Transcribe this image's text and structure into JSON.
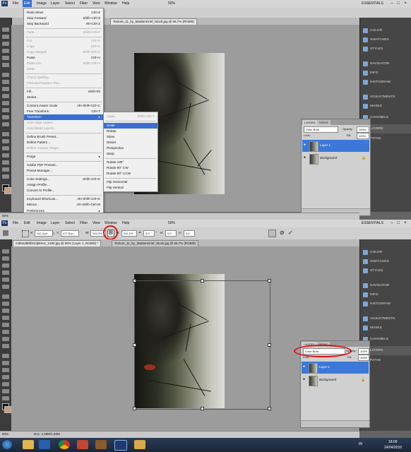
{
  "menubar": {
    "items": [
      "Ps",
      "File",
      "Edit",
      "Image",
      "Layer",
      "Select",
      "Filter",
      "View",
      "Window",
      "Help"
    ],
    "zoom": "50%",
    "workspace": "ESSENTIALS"
  },
  "edit_menu": {
    "items": [
      {
        "label": "Redo Move",
        "shortcut": "Ctrl+Z",
        "disabled": false
      },
      {
        "label": "Step Forward",
        "shortcut": "Shift+Ctrl+Z",
        "disabled": false
      },
      {
        "label": "Step Backward",
        "shortcut": "Alt+Ctrl+Z",
        "disabled": false
      },
      {
        "label": "Fade...",
        "shortcut": "Shift+Ctrl+F",
        "disabled": true
      },
      {
        "label": "Cut",
        "shortcut": "Ctrl+X",
        "disabled": true
      },
      {
        "label": "Copy",
        "shortcut": "Ctrl+C",
        "disabled": true
      },
      {
        "label": "Copy Merged",
        "shortcut": "Shift+Ctrl+C",
        "disabled": true
      },
      {
        "label": "Paste",
        "shortcut": "Ctrl+V",
        "disabled": false
      },
      {
        "label": "Paste Into",
        "shortcut": "Shift+Ctrl+V",
        "disabled": true
      },
      {
        "label": "Clear",
        "shortcut": "",
        "disabled": true
      },
      {
        "label": "Check Spelling...",
        "shortcut": "",
        "disabled": true
      },
      {
        "label": "Find and Replace Text...",
        "shortcut": "",
        "disabled": true
      },
      {
        "label": "Fill...",
        "shortcut": "Shift+F5",
        "disabled": false
      },
      {
        "label": "Stroke...",
        "shortcut": "",
        "disabled": false
      },
      {
        "label": "Content-Aware Scale",
        "shortcut": "Alt+Shift+Ctrl+C",
        "disabled": false
      },
      {
        "label": "Free Transform",
        "shortcut": "Ctrl+T",
        "disabled": false
      },
      {
        "label": "Transform",
        "shortcut": "",
        "disabled": false,
        "highlight": true
      },
      {
        "label": "Auto-Align Layers...",
        "shortcut": "",
        "disabled": true
      },
      {
        "label": "Auto-Blend Layers...",
        "shortcut": "",
        "disabled": true
      },
      {
        "label": "Define Brush Preset...",
        "shortcut": "",
        "disabled": false
      },
      {
        "label": "Define Pattern...",
        "shortcut": "",
        "disabled": false
      },
      {
        "label": "Define Custom Shape...",
        "shortcut": "",
        "disabled": true
      },
      {
        "label": "Purge",
        "shortcut": "",
        "disabled": false
      },
      {
        "label": "Adobe PDF Presets...",
        "shortcut": "",
        "disabled": false
      },
      {
        "label": "Preset Manager...",
        "shortcut": "",
        "disabled": false
      },
      {
        "label": "Color Settings...",
        "shortcut": "Shift+Ctrl+K",
        "disabled": false
      },
      {
        "label": "Assign Profile...",
        "shortcut": "",
        "disabled": false
      },
      {
        "label": "Convert to Profile...",
        "shortcut": "",
        "disabled": false
      },
      {
        "label": "Keyboard Shortcuts...",
        "shortcut": "Alt+Shift+Ctrl+K",
        "disabled": false
      },
      {
        "label": "Menus...",
        "shortcut": "Alt+Shift+Ctrl+M",
        "disabled": false
      },
      {
        "label": "Preferences",
        "shortcut": "",
        "disabled": false
      }
    ]
  },
  "transform_submenu": {
    "items": [
      {
        "label": "Again",
        "shortcut": "Shift+Ctrl+T",
        "disabled": true
      },
      {
        "label": "Scale",
        "shortcut": "",
        "highlight": true
      },
      {
        "label": "Rotate",
        "shortcut": ""
      },
      {
        "label": "Skew",
        "shortcut": ""
      },
      {
        "label": "Distort",
        "shortcut": ""
      },
      {
        "label": "Perspective",
        "shortcut": ""
      },
      {
        "label": "Warp",
        "shortcut": ""
      },
      {
        "label": "Rotate 180°",
        "shortcut": ""
      },
      {
        "label": "Rotate 90° CW",
        "shortcut": ""
      },
      {
        "label": "Rotate 90° CCW",
        "shortcut": ""
      },
      {
        "label": "Flip Horizontal",
        "shortcut": ""
      },
      {
        "label": "Flip Vertical",
        "shortcut": ""
      }
    ]
  },
  "top_window": {
    "doc_tab": "Texture_11_by_MadamGrief_Stock.jpg @ 66,7% (RGB/8)",
    "status": "50%"
  },
  "bottom_window": {
    "doc_tabs": [
      {
        "label": "m3l6ndd6fl3r23j8ms1_1280.jpg @ 50% (Layer 1, RGB/8) *",
        "active": true
      },
      {
        "label": "Texture_11_by_MadamGrief_Stock.jpg @ 66,7% (RGB/8)",
        "active": false
      }
    ],
    "options": {
      "x": "412,4 px",
      "y": "477,8 px",
      "w": "311,2%",
      "h": "311,2%",
      "rot": "0,0",
      "hskew": "0,0",
      "vskew": "0,0"
    },
    "status_zoom": "50%",
    "status_doc": "Doc: 1,59M/1,59M"
  },
  "dock_items": [
    {
      "label": "COLOR",
      "icon": "color-icon"
    },
    {
      "label": "SWATCHES",
      "icon": "swatches-icon"
    },
    {
      "label": "STYLES",
      "icon": "styles-icon"
    },
    {
      "label": "NAVIGATOR",
      "icon": "navigator-icon"
    },
    {
      "label": "INFO",
      "icon": "info-icon"
    },
    {
      "label": "HISTOGRAM",
      "icon": "histogram-icon"
    },
    {
      "label": "ADJUSTMENTS",
      "icon": "adjustments-icon"
    },
    {
      "label": "MASKS",
      "icon": "masks-icon"
    },
    {
      "label": "CHANNELS",
      "icon": "channels-icon"
    },
    {
      "label": "LAYERS",
      "icon": "layers-icon",
      "highlight": true
    },
    {
      "label": "PATHS",
      "icon": "paths-icon"
    }
  ],
  "layers_panel": {
    "tabs": [
      "LAYERS",
      "PATHS"
    ],
    "blend_mode": "Color Burn",
    "opacity_label": "Opacity:",
    "opacity": "100%",
    "lock_label": "Lock:",
    "fill_label": "Fill:",
    "fill": "100%",
    "layers": [
      {
        "name": "Layer 1",
        "selected": true
      },
      {
        "name": "Background",
        "selected": false
      }
    ]
  },
  "taskbar": {
    "time": "18:09",
    "date": "24/04/2016",
    "lang": "IN"
  },
  "colors": {
    "highlight": "#3a6fd1",
    "annotation": "#e01010"
  }
}
